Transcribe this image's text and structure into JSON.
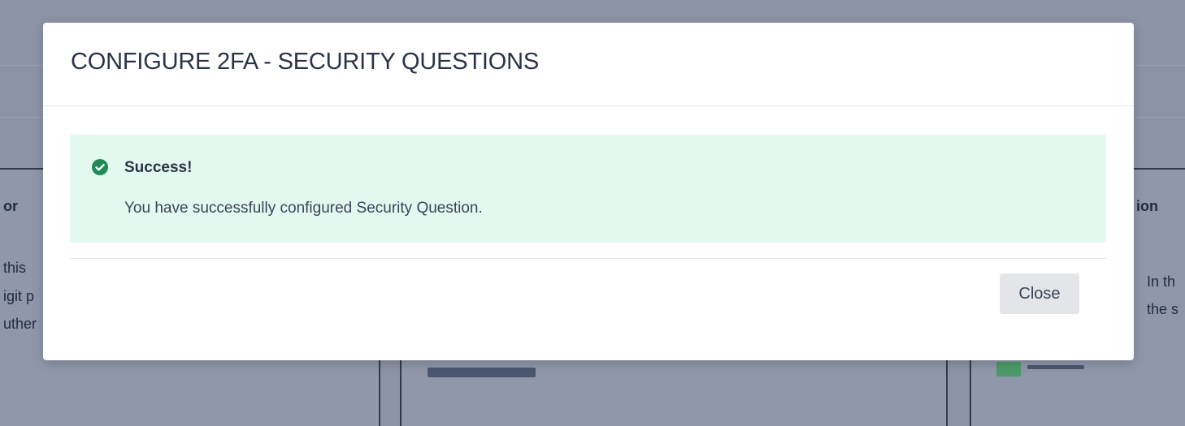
{
  "modal": {
    "title": "CONFIGURE 2FA - SECURITY QUESTIONS",
    "alert": {
      "icon": "check-circle-icon",
      "title": "Success!",
      "message": "You have successfully configured Security Question."
    },
    "close_label": "Close"
  },
  "background": {
    "left_card": {
      "title_fragment": "or",
      "text_fragments": [
        "this",
        "igit p",
        "uther"
      ]
    },
    "right_card": {
      "title_fragment": "ion",
      "text_fragments": [
        "In th",
        "the s"
      ]
    }
  },
  "colors": {
    "overlay": "#8b93a6",
    "success_bg": "#e3f8ee",
    "success_icon": "#1f8a55",
    "title_text": "#2a3348"
  }
}
